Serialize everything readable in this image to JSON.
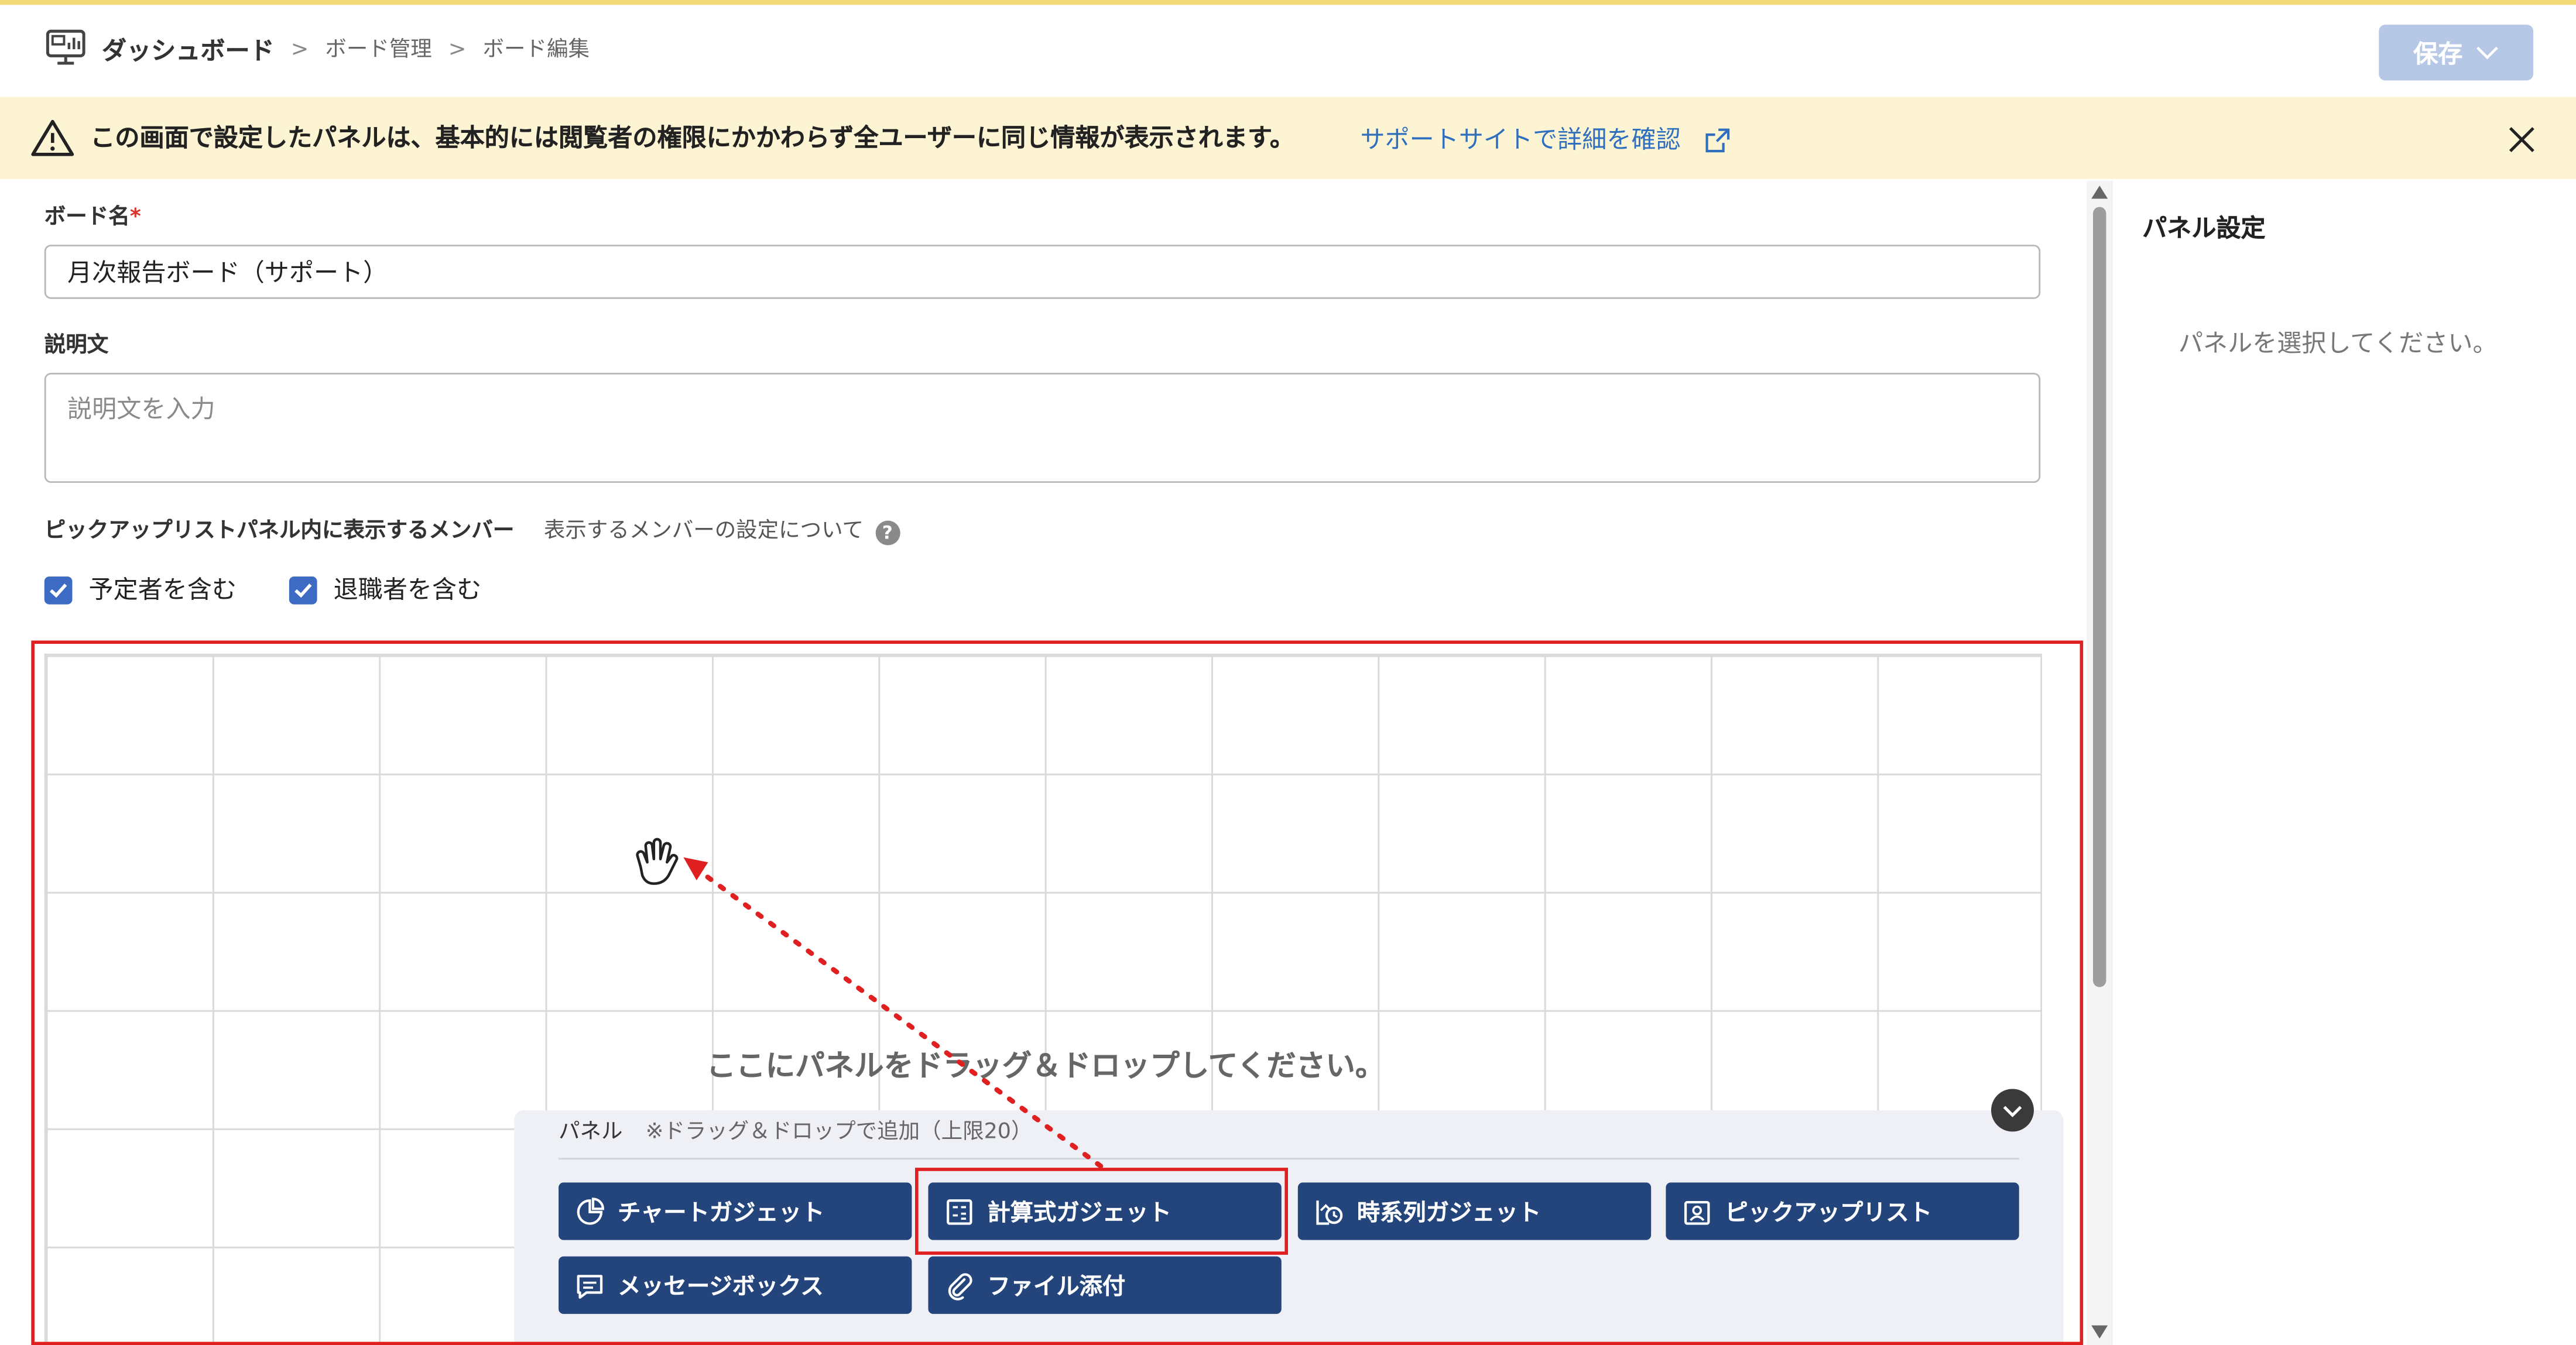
{
  "header": {
    "title": "ダッシュボード",
    "breadcrumb": [
      "ボード管理",
      "ボード編集"
    ],
    "breadcrumb_separator": ">",
    "save_label": "保存"
  },
  "notice": {
    "message": "この画面で設定したパネルは、基本的には閲覧者の権限にかかわらず全ユーザーに同じ情報が表示されます。",
    "link_label": "サポートサイトで詳細を確認",
    "close_icon": "close-icon",
    "warning_icon": "warning-icon"
  },
  "form": {
    "board_name_label": "ボード名",
    "required_mark": "*",
    "board_name_value": "月次報告ボード（サポート）",
    "description_label": "説明文",
    "description_placeholder": "説明文を入力",
    "members_label": "ピックアップリストパネル内に表示するメンバー",
    "members_help_link": "表示するメンバーの設定について",
    "help_icon_glyph": "?",
    "checkboxes": [
      {
        "label": "予定者を含む",
        "checked": true
      },
      {
        "label": "退職者を含む",
        "checked": true
      }
    ]
  },
  "canvas": {
    "drop_hint": "ここにパネルをドラッグ＆ドロップしてください。"
  },
  "palette": {
    "title": "パネル",
    "note": "※ドラッグ＆ドロップで追加（上限20）",
    "gadgets": [
      {
        "label": "チャートガジェット",
        "icon": "pie-chart-icon"
      },
      {
        "label": "計算式ガジェット",
        "icon": "calculator-icon"
      },
      {
        "label": "時系列ガジェット",
        "icon": "timeline-chart-icon"
      },
      {
        "label": "ピックアップリスト",
        "icon": "person-list-icon"
      },
      {
        "label": "メッセージボックス",
        "icon": "message-icon"
      },
      {
        "label": "ファイル添付",
        "icon": "paperclip-icon"
      }
    ]
  },
  "side_panel": {
    "title": "パネル設定",
    "empty_message": "パネルを選択してください。"
  },
  "colors": {
    "accent": "#24457c",
    "save_disabled": "#b6c8e6",
    "notice_bg": "#fcf4d3",
    "link": "#2f6fbe",
    "annotation_red": "#e02020",
    "checkbox": "#3d6bc4"
  }
}
